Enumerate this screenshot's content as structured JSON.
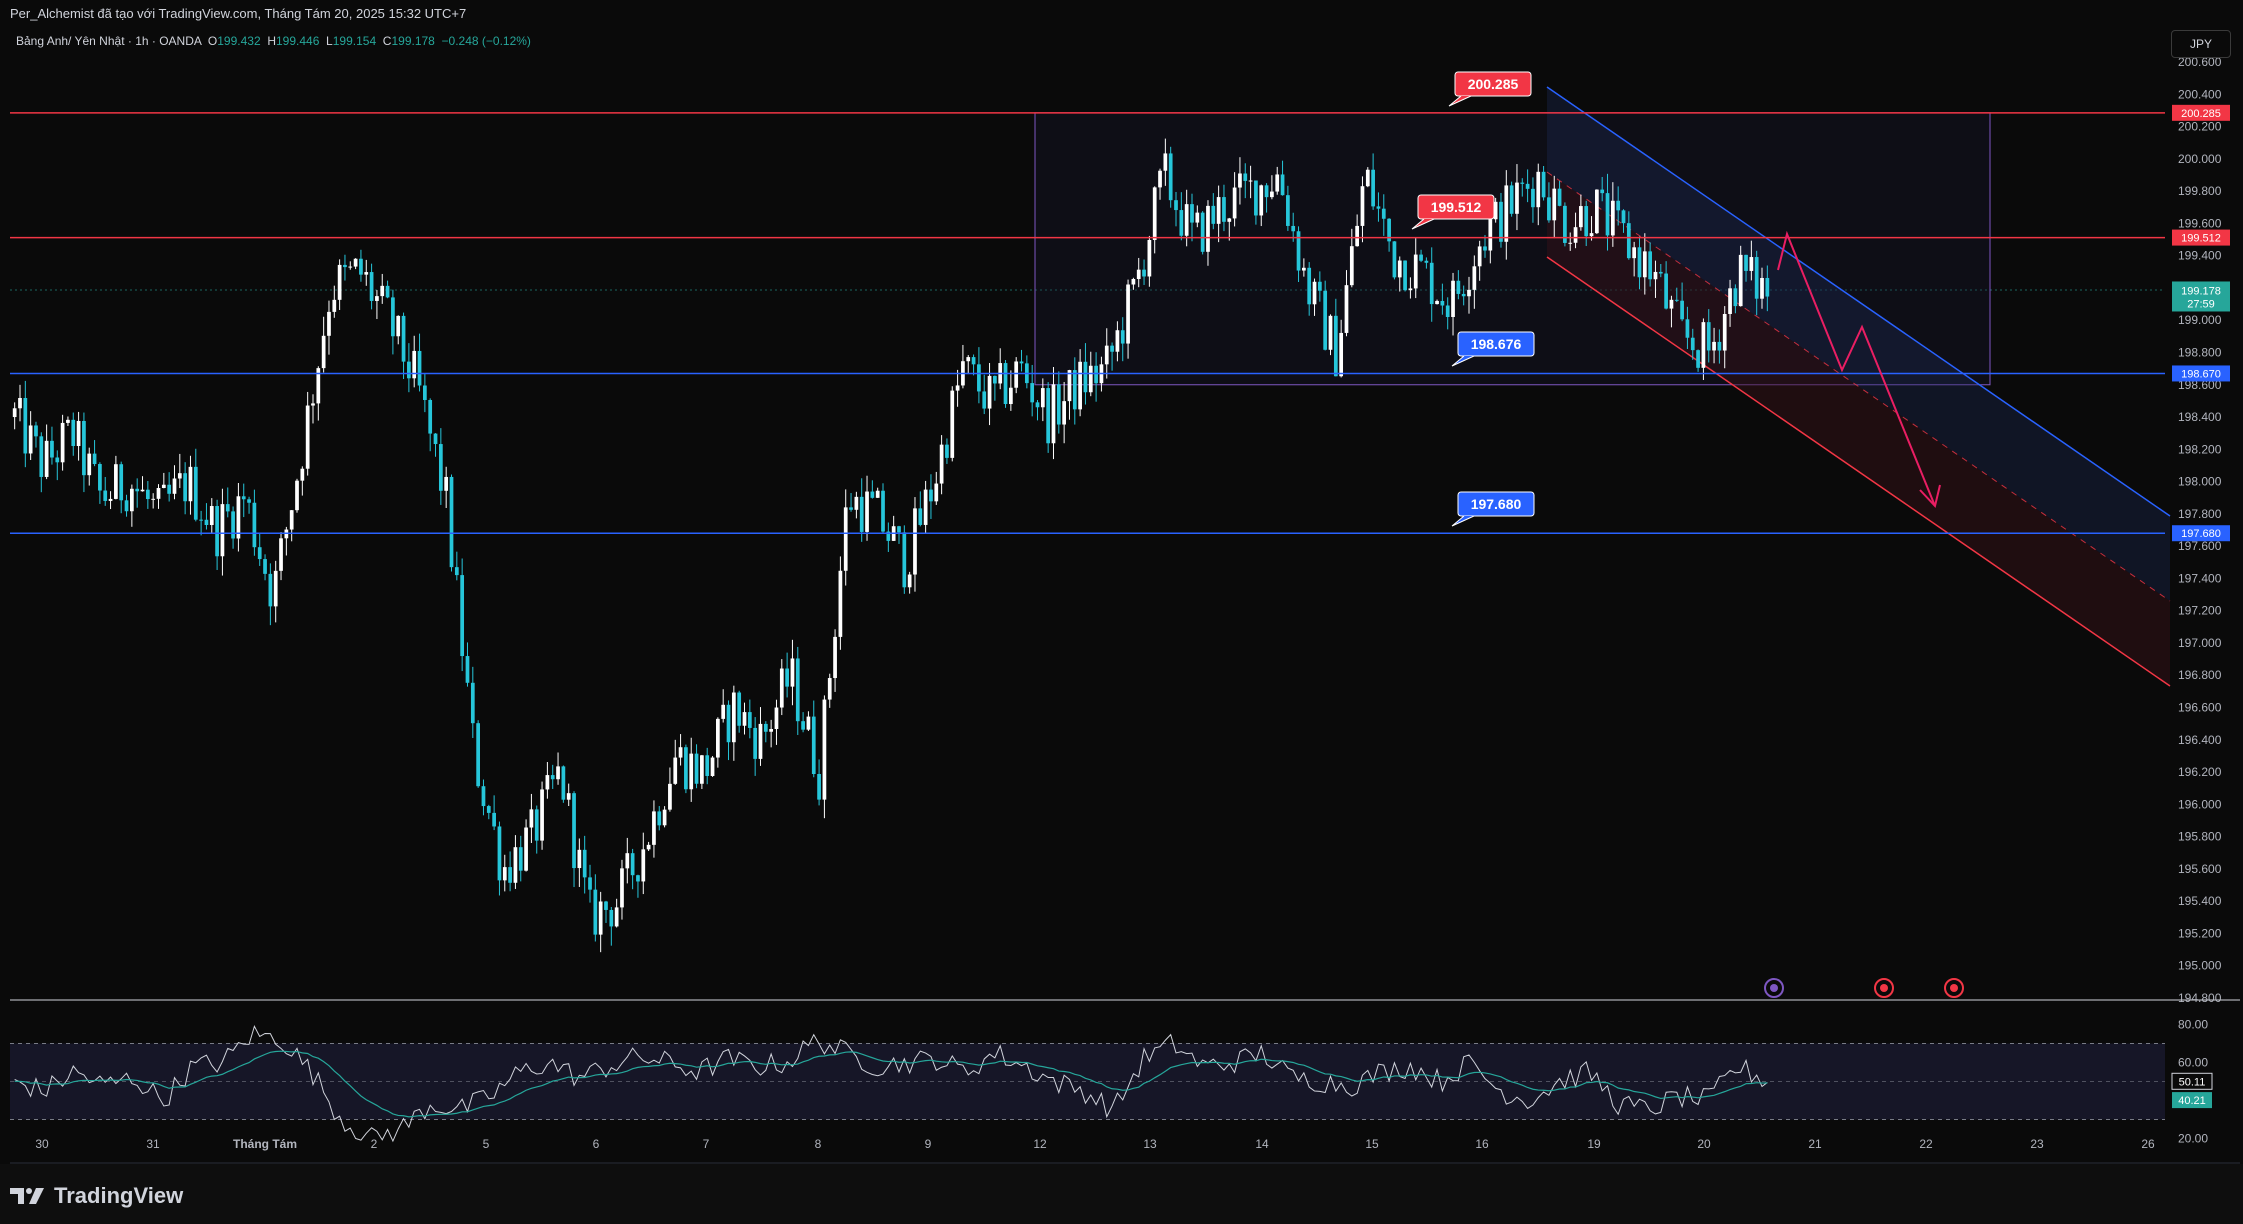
{
  "header": {
    "title": "Per_Alchemist đã tạo với TradingView.com, Tháng Tám 20, 2025 15:32 UTC+7"
  },
  "legend": {
    "symbol": "Bảng Anh/ Yên Nhật · 1h · OANDA",
    "open_label": "O",
    "open": "199.432",
    "high_label": "H",
    "high": "199.446",
    "low_label": "L",
    "low": "199.154",
    "close_label": "C",
    "close": "199.178",
    "change": "−0.248 (−0.12%)"
  },
  "currency_button": "JPY",
  "brand": "TradingView",
  "colors": {
    "background": "#0a0a0a",
    "red_line": "#f23645",
    "blue_line": "#2962ff",
    "rsi_line": "#d1d4dc",
    "rsi_ma": "#26a69a",
    "arrow": "#e91e63",
    "box": "#7e57c2"
  },
  "price_axis": {
    "labels": [
      "200.600",
      "200.400",
      "200.200",
      "200.000",
      "199.800",
      "199.600",
      "199.400",
      "199.200",
      "199.000",
      "198.800",
      "198.600",
      "198.400",
      "198.200",
      "198.000",
      "197.800",
      "197.600",
      "197.400",
      "197.200",
      "197.000",
      "196.800",
      "196.600",
      "196.400",
      "196.200",
      "196.000",
      "195.800",
      "195.600",
      "195.400",
      "195.200",
      "195.000",
      "194.800"
    ],
    "current_price": "199.178",
    "countdown": "27:59"
  },
  "horizontal_levels": [
    {
      "value": 200.285,
      "label": "200.285",
      "axis_label": "200.285",
      "color": "red"
    },
    {
      "value": 199.512,
      "label": "199.512",
      "axis_label": "199.512",
      "color": "red"
    },
    {
      "value": 198.67,
      "label": "198.676",
      "axis_label": "198.670",
      "color": "blue"
    },
    {
      "value": 197.68,
      "label": "197.680",
      "axis_label": "197.680",
      "color": "blue"
    }
  ],
  "time_axis": {
    "labels": [
      "30",
      "31",
      "Tháng Tám",
      "2",
      "5",
      "6",
      "7",
      "8",
      "9",
      "12",
      "13",
      "14",
      "15",
      "16",
      "19",
      "20",
      "21",
      "22",
      "23",
      "26"
    ]
  },
  "rsi": {
    "axis_labels": [
      "80.00",
      "60.00",
      "20.00"
    ],
    "value": "50.11",
    "ma_value": "40.21",
    "upper": 70,
    "lower": 30
  },
  "chart_data": {
    "type": "candlestick",
    "symbol": "GBPJPY",
    "timeframe": "1h",
    "ylim": [
      194.8,
      200.6
    ],
    "x_labels": [
      "30",
      "31",
      "Tháng Tám",
      "2",
      "5",
      "6",
      "7",
      "8",
      "9",
      "12",
      "13",
      "14",
      "15",
      "16",
      "19",
      "20",
      "21",
      "22",
      "23",
      "26"
    ],
    "levels": [
      200.285,
      199.512,
      198.67,
      197.68
    ],
    "path_close": [
      198.4,
      198.1,
      198.3,
      197.9,
      198.0,
      197.8,
      198.0,
      197.7,
      197.9,
      197.3,
      198.2,
      199.2,
      199.3,
      199.0,
      198.6,
      197.9,
      196.3,
      195.6,
      195.8,
      196.2,
      195.3,
      195.4,
      195.8,
      196.3,
      196.2,
      196.6,
      196.4,
      196.8,
      196.2,
      197.9,
      197.8,
      197.5,
      198.0,
      198.7,
      198.5,
      198.7,
      198.4,
      198.6,
      198.7,
      199.2,
      199.9,
      199.5,
      199.7,
      199.8,
      199.9,
      199.2,
      198.8,
      199.9,
      199.4,
      199.3,
      199.1,
      199.5,
      199.7,
      199.9,
      199.6,
      199.7,
      199.5,
      199.3,
      198.9,
      198.8,
      199.3,
      199.18
    ],
    "rsi_series": [
      50,
      45,
      55,
      48,
      52,
      40,
      58,
      60,
      75,
      72,
      55,
      30,
      20,
      25,
      38,
      35,
      42,
      55,
      60,
      52,
      58,
      63,
      60,
      55,
      62,
      58,
      60,
      72,
      65,
      58,
      60,
      62,
      55,
      65,
      58,
      50,
      45,
      35,
      62,
      70,
      58,
      60,
      65,
      52,
      50,
      48,
      55,
      58,
      50,
      60,
      45,
      40,
      50,
      55,
      38,
      35,
      42,
      40,
      58,
      50
    ]
  }
}
